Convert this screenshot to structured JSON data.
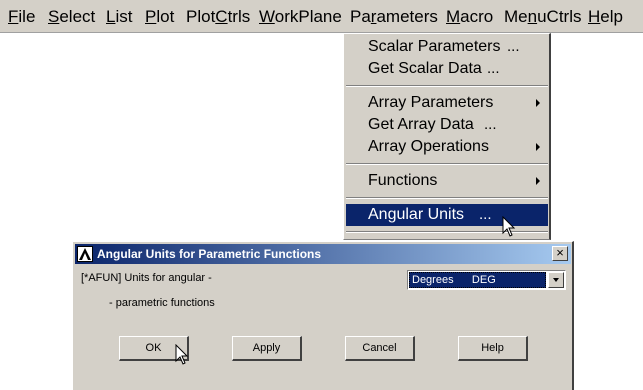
{
  "menubar": {
    "items": [
      {
        "label": "File",
        "accel": "F"
      },
      {
        "label": "Select",
        "accel": "S"
      },
      {
        "label": "List",
        "accel": "L"
      },
      {
        "label": "Plot",
        "accel": "P"
      },
      {
        "label": "PlotCtrls",
        "accel": "C"
      },
      {
        "label": "WorkPlane",
        "accel": "W"
      },
      {
        "label": "Parameters",
        "accel": "r"
      },
      {
        "label": "Macro",
        "accel": "M"
      },
      {
        "label": "MenuCtrls",
        "accel": "n"
      },
      {
        "label": "Help",
        "accel": "H"
      }
    ]
  },
  "parameters_menu": {
    "items": [
      {
        "label": "Scalar Parameters",
        "suffix": "..."
      },
      {
        "label": "Get Scalar Data",
        "suffix": "..."
      },
      {
        "label": "Array Parameters",
        "submenu": true
      },
      {
        "label": "Get Array Data",
        "suffix": "..."
      },
      {
        "label": "Array Operations",
        "submenu": true
      },
      {
        "label": "Functions",
        "submenu": true
      },
      {
        "label": "Angular Units",
        "suffix": "...",
        "selected": true
      }
    ]
  },
  "dialog": {
    "title": "Angular Units for Parametric Functions",
    "close_glyph": "×",
    "prompt_line1": "[*AFUN]  Units for angular -",
    "prompt_line2": "- parametric functions",
    "select_value": "Degrees      DEG",
    "buttons": {
      "ok": "OK",
      "apply": "Apply",
      "cancel": "Cancel",
      "help": "Help"
    }
  },
  "colors": {
    "chrome": "#d4d0c8",
    "selection": "#0a246a",
    "title_gradient_end": "#a6caf0"
  }
}
